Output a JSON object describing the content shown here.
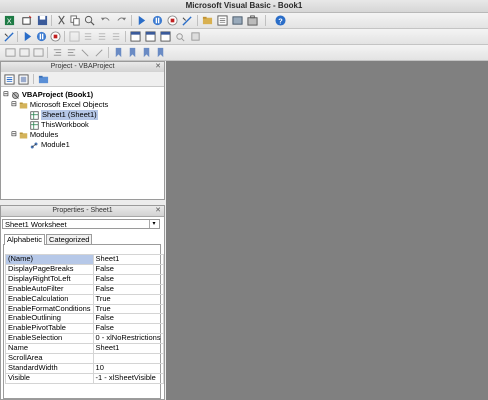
{
  "window": {
    "title": "Microsoft Visual Basic - Book1"
  },
  "colors": {
    "accent": "#2a6dc8",
    "selection": "#b6c8e8",
    "workspace": "#808080",
    "play": "#2a6dc8",
    "stop": "#c02020"
  },
  "project": {
    "header": "Project - VBAProject",
    "root": "VBAProject (Book1)",
    "folder_excel": "Microsoft Excel Objects",
    "sheet1": "Sheet1 (Sheet1)",
    "workbook": "ThisWorkbook",
    "folder_modules": "Modules",
    "module1": "Module1"
  },
  "properties": {
    "header": "Properties - Sheet1",
    "object": "Sheet1 Worksheet",
    "tab_alpha": "Alphabetic",
    "tab_cat": "Categorized",
    "rows": [
      {
        "k": "(Name)",
        "v": "Sheet1"
      },
      {
        "k": "DisplayPageBreaks",
        "v": "False"
      },
      {
        "k": "DisplayRightToLeft",
        "v": "False"
      },
      {
        "k": "EnableAutoFilter",
        "v": "False"
      },
      {
        "k": "EnableCalculation",
        "v": "True"
      },
      {
        "k": "EnableFormatConditions",
        "v": "True"
      },
      {
        "k": "EnableOutlining",
        "v": "False"
      },
      {
        "k": "EnablePivotTable",
        "v": "False"
      },
      {
        "k": "EnableSelection",
        "v": "0 - xlNoRestrictions"
      },
      {
        "k": "Name",
        "v": "Sheet1"
      },
      {
        "k": "ScrollArea",
        "v": ""
      },
      {
        "k": "StandardWidth",
        "v": "10"
      },
      {
        "k": "Visible",
        "v": "-1 - xlSheetVisible"
      }
    ]
  }
}
